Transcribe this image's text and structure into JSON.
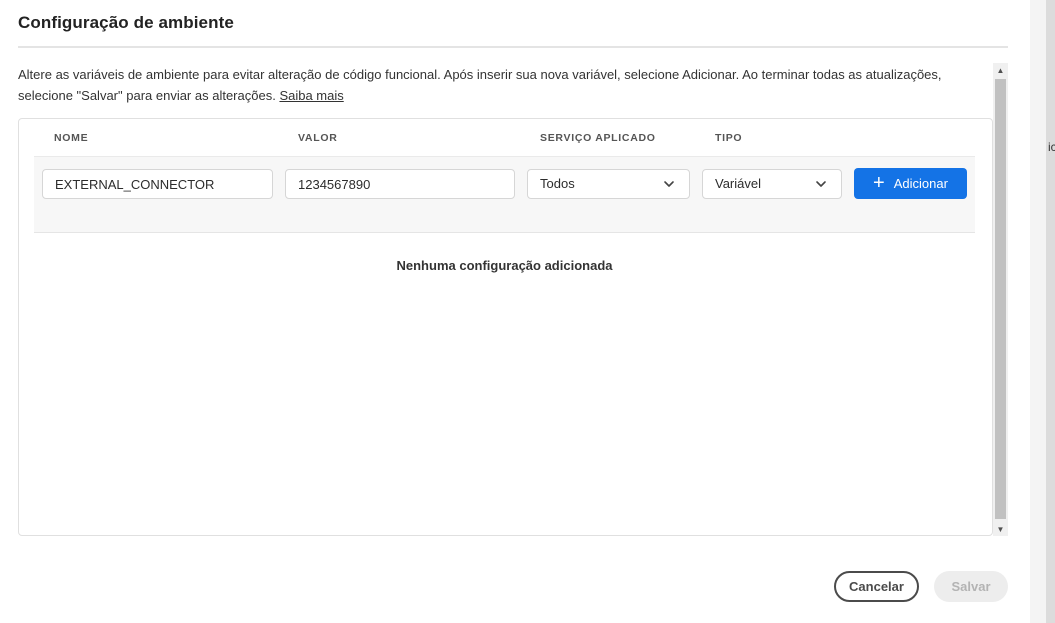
{
  "dialog": {
    "title": "Configuração de ambiente",
    "description": "Altere as variáveis de ambiente para evitar alteração de código funcional. Após inserir sua nova variável, selecione Adicionar. Ao terminar todas as atualizações, selecione \"Salvar\" para enviar as alterações.",
    "learn_more_link": "Saiba mais"
  },
  "table": {
    "columns": [
      "NOME",
      "VALOR",
      "SERVIÇO APLICADO",
      "TIPO"
    ],
    "inputs": {
      "name_value": "EXTERNAL_CONNECTOR",
      "value_value": "1234567890",
      "service_selected": "Todos",
      "type_selected": "Variável"
    },
    "add_button_label": "Adicionar",
    "add_icon": "plus-icon",
    "empty_message": "Nenhuma configuração adicionada"
  },
  "footer": {
    "cancel_label": "Cancelar",
    "save_label": "Salvar"
  },
  "background": {
    "fragment_text": "ic"
  },
  "colors": {
    "accent": "#1473e6",
    "disabled_bg": "#ededed",
    "disabled_text": "#b3b3b3"
  }
}
